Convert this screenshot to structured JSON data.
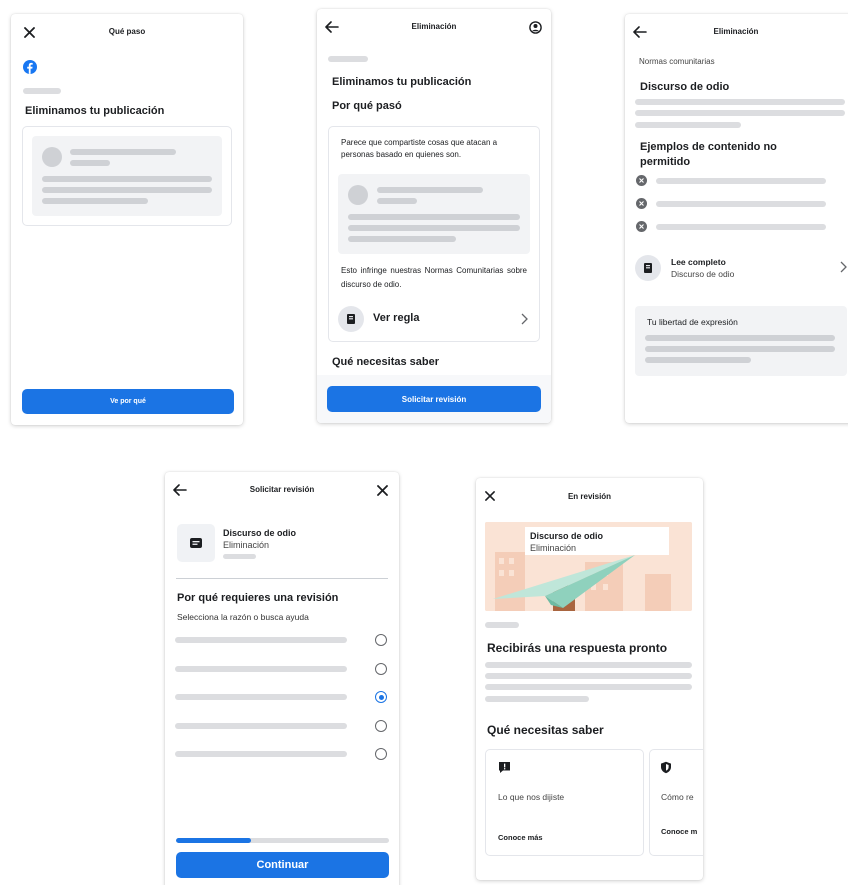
{
  "screen1": {
    "title": "Qué paso",
    "heading": "Eliminamos tu publicación",
    "button": "Ve por qué"
  },
  "screen2": {
    "title": "Eliminación",
    "heading": "Eliminamos tu publicación",
    "subheading": "Por qué pasó",
    "card_text": "Parece que compartiste cosas que atacan a personas basado en quienes son.",
    "violation_text": "Esto infringe nuestras Normas Comunitarias sobre discurso de odio.",
    "rule_link": "Ver regla",
    "section": "Qué necesitas saber",
    "button": "Solicitar revisión"
  },
  "screen3": {
    "title": "Eliminación",
    "breadcrumb": "Normas comunitarias",
    "heading": "Discurso de odio",
    "examples_heading": "Ejemplos de contenido no permitido",
    "read_full_title": "Lee completo",
    "read_full_sub": "Discurso de odio",
    "freedom_title": "Tu libertad de expresión"
  },
  "screen4": {
    "title": "Solicitar revisión",
    "item_title": "Discurso de odio",
    "item_sub": "Eliminación",
    "heading": "Por qué requieres una revisión",
    "subtext": "Selecciona la razón o busca ayuda",
    "progress": 0.35,
    "button": "Continuar"
  },
  "screen5": {
    "title": "En revisión",
    "banner_title": "Discurso de odio",
    "banner_sub": "Eliminación",
    "heading": "Recibirás una respuesta pronto",
    "section": "Qué necesitas saber",
    "cards": [
      {
        "text": "Lo que nos dijiste",
        "link": "Conoce más"
      },
      {
        "text": "Cómo re",
        "link": "Conoce m"
      }
    ]
  },
  "colors": {
    "primary": "#1b74e4",
    "facebook": "#1877f2",
    "placeholder": "#dcdde0"
  }
}
